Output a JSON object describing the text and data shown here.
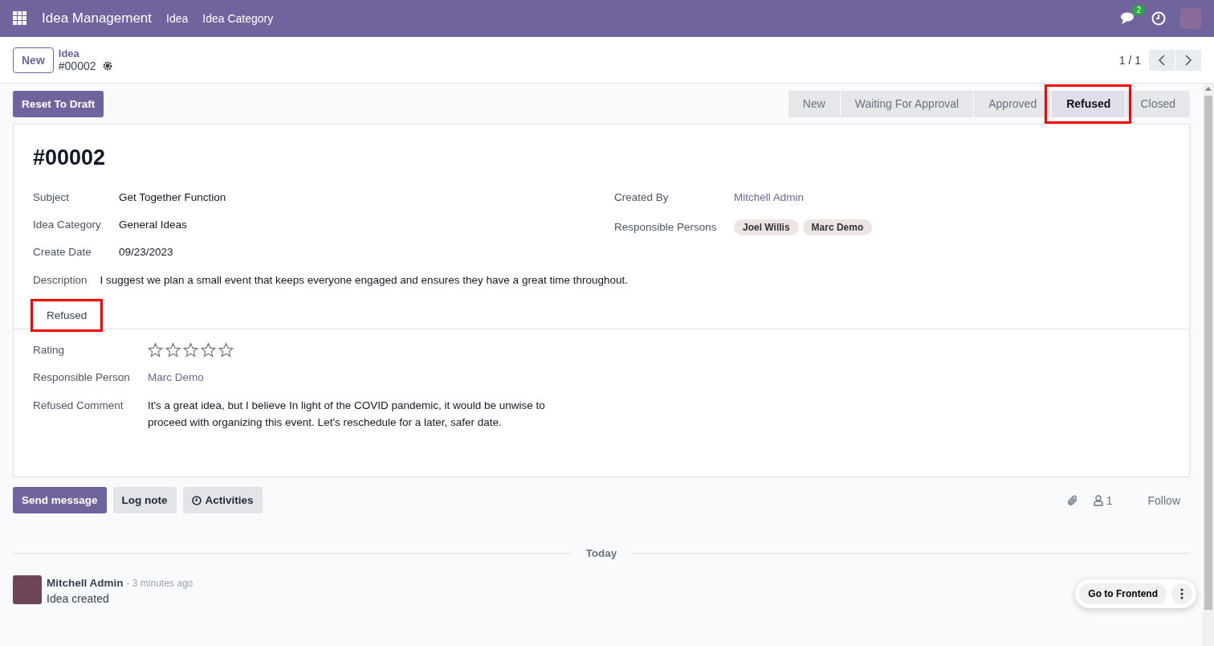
{
  "navbar": {
    "app_name": "Idea Management",
    "menus": [
      "Idea",
      "Idea Category"
    ],
    "message_count": "2"
  },
  "control_panel": {
    "new_button": "New",
    "breadcrumb": "Idea",
    "record": "#00002",
    "pager": "1 / 1"
  },
  "action_button": "Reset To Draft",
  "status_steps": [
    {
      "label": "New",
      "selected": false,
      "highlighted": false
    },
    {
      "label": "Waiting For Approval",
      "selected": false,
      "highlighted": false
    },
    {
      "label": "Approved",
      "selected": false,
      "highlighted": false
    },
    {
      "label": "Refused",
      "selected": true,
      "highlighted": true
    },
    {
      "label": "Closed",
      "selected": false,
      "highlighted": false
    }
  ],
  "form": {
    "title": "#00002",
    "left_fields": [
      {
        "label": "Subject",
        "value": "Get Together Function"
      },
      {
        "label": "Idea Category",
        "value": "General Ideas"
      },
      {
        "label": "Create Date",
        "value": "09/23/2023"
      }
    ],
    "created_by": {
      "label": "Created By",
      "value": "Mitchell Admin"
    },
    "responsible_persons": {
      "label": "Responsible Persons",
      "tags": [
        "Joel Willis",
        "Marc Demo"
      ]
    },
    "description": {
      "label": "Description",
      "value": "I suggest we plan a small event that keeps everyone engaged and ensures they have a great time throughout."
    },
    "tabs": [
      {
        "label": "Refused",
        "selected": true,
        "highlighted": true
      }
    ],
    "rating": {
      "label": "Rating",
      "stars": 0
    },
    "responsible_person": {
      "label": "Responsible Person",
      "value": "Marc Demo"
    },
    "refused_comment": {
      "label": "Refused Comment",
      "value": "It's a great idea, but I believe In light of the COVID pandemic, it would be unwise to proceed with organizing this event. Let's reschedule for a later, safer date."
    }
  },
  "chatter": {
    "buttons": [
      {
        "label": "Send message",
        "kind": "primary"
      },
      {
        "label": "Log note",
        "kind": "secondary"
      },
      {
        "label": "Activities",
        "kind": "activities"
      }
    ],
    "followers": "1",
    "follow": "Follow",
    "date_separator": "Today",
    "messages": [
      {
        "author": "Mitchell Admin",
        "time": "- 3 minutes ago",
        "body": "Idea created"
      }
    ]
  },
  "frontend": {
    "label": "Go to Frontend"
  }
}
